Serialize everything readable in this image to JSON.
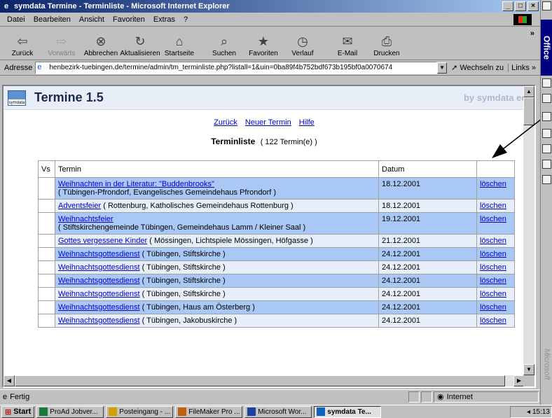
{
  "window": {
    "title": "symdata Termine - Terminliste - Microsoft Internet Explorer",
    "controls": [
      "_",
      "□",
      "×"
    ]
  },
  "menu": [
    "Datei",
    "Bearbeiten",
    "Ansicht",
    "Favoriten",
    "Extras",
    "?"
  ],
  "toolbar": {
    "buttons": [
      {
        "label": "Zurück",
        "icon": "back-arrow-icon",
        "glyph": "⇦"
      },
      {
        "label": "Vorwärts",
        "icon": "forward-arrow-icon",
        "glyph": "⇨"
      },
      {
        "label": "Abbrechen",
        "icon": "stop-icon",
        "glyph": "⊗"
      },
      {
        "label": "Aktualisieren",
        "icon": "refresh-icon",
        "glyph": "↻"
      },
      {
        "label": "Startseite",
        "icon": "home-icon",
        "glyph": "⌂"
      },
      {
        "label": "Suchen",
        "icon": "search-icon",
        "glyph": "⌕"
      },
      {
        "label": "Favoriten",
        "icon": "favorites-icon",
        "glyph": "★"
      },
      {
        "label": "Verlauf",
        "icon": "history-icon",
        "glyph": "◷"
      },
      {
        "label": "E-Mail",
        "icon": "mail-icon",
        "glyph": "✉"
      },
      {
        "label": "Drucken",
        "icon": "print-icon",
        "glyph": "⎙"
      }
    ],
    "more": "»"
  },
  "address": {
    "label": "Adresse",
    "url": "henbezirk-tuebingen.de/termine/admin/tm_terminliste.php?listall=1&uin=0ba89f4b752bdf673b195bf0a0070674",
    "go_label": "Wechseln zu",
    "links_label": "Links »"
  },
  "app": {
    "logo_text": "symdata",
    "title": "Termine 1.5",
    "by": "by symdata edv gn"
  },
  "nav": {
    "back": "Zurück",
    "new": "Neuer Termin",
    "help": "Hilfe"
  },
  "list": {
    "title": "Terminliste",
    "count": "( 122 Termin(e) )"
  },
  "table": {
    "headers": {
      "vs": "Vs",
      "termin": "Termin",
      "datum": "Datum",
      "action": ""
    },
    "rows": [
      {
        "link": "Weihnachten in der Literatur: \"Buddenbrooks\"",
        "detail": "( Tübingen-Pfrondorf, Evangelisches Gemeindehaus Pfrondorf )",
        "date": "18.12.2001",
        "action": "löschen"
      },
      {
        "link": "Adventsfeier",
        "detail": "( Rottenburg, Katholisches Gemeindehaus Rottenburg )",
        "date": "18.12.2001",
        "action": "löschen"
      },
      {
        "link": "Weihnachtsfeier",
        "detail": "( Stiftskirchengemeinde Tübingen, Gemeindehaus Lamm / Kleiner Saal )",
        "date": "19.12.2001",
        "action": "löschen"
      },
      {
        "link": "Gottes vergessene Kinder",
        "detail": "( Mössingen, Lichtspiele Mössingen, Höfgasse )",
        "date": "21.12.2001",
        "action": "löschen"
      },
      {
        "link": "Weihnachtsgottesdienst",
        "detail": "( Tübingen, Stiftskirche )",
        "date": "24.12.2001",
        "action": "löschen"
      },
      {
        "link": "Weihnachtsgottesdienst",
        "detail": "( Tübingen, Stiftskirche )",
        "date": "24.12.2001",
        "action": "löschen"
      },
      {
        "link": "Weihnachtsgottesdienst",
        "detail": "( Tübingen, Stiftskirche )",
        "date": "24.12.2001",
        "action": "löschen"
      },
      {
        "link": "Weihnachtsgottesdienst",
        "detail": "( Tübingen, Stiftskirche )",
        "date": "24.12.2001",
        "action": "löschen"
      },
      {
        "link": "Weihnachtsgottesdienst",
        "detail": "( Tübingen, Haus am Österberg )",
        "date": "24.12.2001",
        "action": "löschen"
      },
      {
        "link": "Weihnachtsgottesdienst",
        "detail": "( Tübingen, Jakobuskirche )",
        "date": "24.12.2001",
        "action": "löschen"
      }
    ]
  },
  "status": {
    "text": "Fertig",
    "zone": "Internet"
  },
  "taskbar": {
    "start": "Start",
    "tasks": [
      {
        "label": "ProAd Jobver...",
        "active": false,
        "color": "#1a7a3a"
      },
      {
        "label": "Posteingang - ...",
        "active": false,
        "color": "#d0a000"
      },
      {
        "label": "FileMaker Pro ...",
        "active": false,
        "color": "#c06010"
      },
      {
        "label": "Microsoft Wor...",
        "active": false,
        "color": "#2040a0"
      },
      {
        "label": "symdata Te...",
        "active": true,
        "color": "#1060c0"
      }
    ],
    "clock": "15:13"
  },
  "officebar": {
    "title": "Office",
    "brand": "Microsoft"
  },
  "colors": {
    "row_dark": "#aac8f5",
    "row_light": "#e6eefa",
    "link": "#0000cc",
    "titlebar": "#0a246a"
  }
}
